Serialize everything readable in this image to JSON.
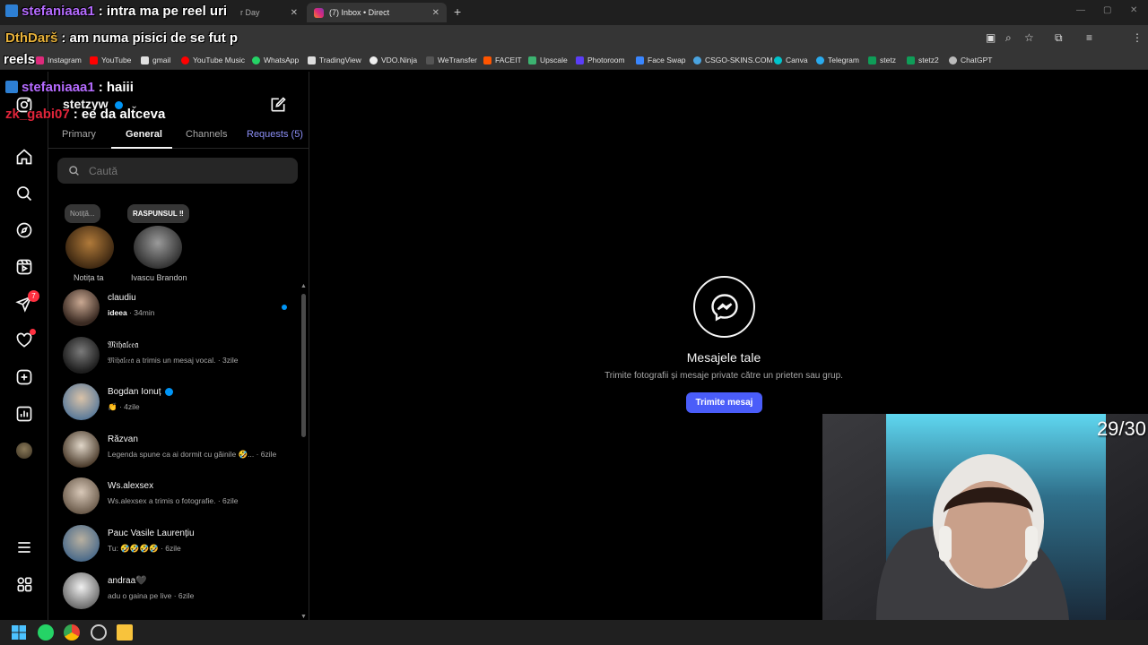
{
  "browser": {
    "tabs": [
      {
        "title": "r Day",
        "active": false
      },
      {
        "title": "(7) Inbox • Direct",
        "active": true
      }
    ],
    "bookmarks": [
      "Instagram",
      "YouTube",
      "gmail",
      "YouTube Music",
      "WhatsApp",
      "TradingView",
      "VDO.Ninja",
      "WeTransfer",
      "FACEIT",
      "Upscale",
      "Photoroom",
      "Face Swap",
      "CSGO-SKINS.COM",
      "Canva",
      "Telegram",
      "stetz",
      "stetz2",
      "ChatGPT"
    ]
  },
  "stream_chat": [
    {
      "user": "stefaniaaa1",
      "message": ": intra ma pe reel uri",
      "color": "#b56bff"
    },
    {
      "user": "DthDarš",
      "message": ": am numa pisici de se fut p",
      "color": "#e8b23a"
    },
    {
      "user": "",
      "message": "reels",
      "color": "#ffffff"
    },
    {
      "user": "stefaniaaa1",
      "message": ": haiii",
      "color": "#b56bff"
    },
    {
      "user": "zk_gabi07",
      "message": ": ee da altceva",
      "color": "#e0243a"
    }
  ],
  "instagram": {
    "rail": {
      "messages_badge": "7"
    },
    "account_name": "stetzyw",
    "tabs": {
      "primary": "Primary",
      "general": "General",
      "channels": "Channels",
      "requests": "Requests (5)"
    },
    "search_placeholder": "Caută",
    "notes": [
      {
        "bubble": "Notiță...",
        "label": "Notița ta"
      },
      {
        "bubble": "RASPUNSUL ‼",
        "label": "Ivascu Brandon"
      }
    ],
    "chats": [
      {
        "name": "claudiu",
        "preview_bold": "ideea",
        "preview": " · 34min",
        "unread": true,
        "verified": false
      },
      {
        "name": "𝔐𝔦𝔥𝔞𝔩𝔠𝔢𝔞",
        "preview_bold": "",
        "preview": "𝔐𝔦𝔥𝔞𝔩𝔠𝔢𝔞 a trimis un mesaj vocal. · 3zile",
        "unread": false,
        "verified": false
      },
      {
        "name": "Bogdan Ionuț",
        "preview_bold": "",
        "preview": "👏 · 4zile",
        "unread": false,
        "verified": true
      },
      {
        "name": "Răzvan",
        "preview_bold": "",
        "preview": "Legenda spune ca ai dormit cu găinile 🤣... · 6zile",
        "unread": false,
        "verified": false
      },
      {
        "name": "Ws.alexsex",
        "preview_bold": "",
        "preview": "Ws.alexsex a trimis o fotografie. · 6zile",
        "unread": false,
        "verified": false
      },
      {
        "name": "Pauc Vasile Laurențiu",
        "preview_bold": "",
        "preview": "Tu: 🤣🤣🤣🤣 · 6zile",
        "unread": false,
        "verified": false
      },
      {
        "name": "andraa🖤",
        "preview_bold": "",
        "preview": "adu o gaina pe live · 6zile",
        "unread": false,
        "verified": false
      }
    ],
    "empty_state": {
      "title": "Mesajele tale",
      "subtitle": "Trimite fotografii și mesaje private către un prieten sau grup.",
      "button": "Trimite mesaj"
    }
  },
  "webcam": {
    "counter": "29/30"
  }
}
